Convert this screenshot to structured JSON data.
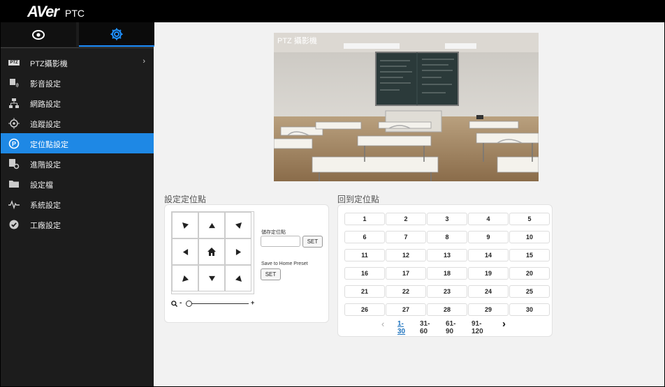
{
  "app": {
    "logo": "AVer",
    "product": "PTC"
  },
  "sidebar": {
    "items": [
      {
        "label": "PTZ攝影機",
        "icon": "ptz-badge-icon",
        "badge": "PTZ",
        "has_arrow": true
      },
      {
        "label": "影音設定",
        "icon": "camera-audio-icon"
      },
      {
        "label": "網路設定",
        "icon": "network-icon"
      },
      {
        "label": "追蹤設定",
        "icon": "tracking-icon"
      },
      {
        "label": "定位點設定",
        "icon": "preset-icon",
        "active": true
      },
      {
        "label": "進階設定",
        "icon": "advanced-settings-icon"
      },
      {
        "label": "設定檔",
        "icon": "folder-icon"
      },
      {
        "label": "系統設定",
        "icon": "pulse-icon"
      },
      {
        "label": "工廠設定",
        "icon": "check-circle-icon"
      }
    ],
    "arrow_glyph": "›"
  },
  "preview": {
    "label": "PTZ 攝影機"
  },
  "set_preset": {
    "title": "設定定位點",
    "save_preset_label": "儲存定位點",
    "set_button": "SET",
    "save_home_label": "Save to Home Preset",
    "set_home_button": "SET",
    "zoom_minus": "-",
    "zoom_plus": "+",
    "zoom_level": 0
  },
  "recall_preset": {
    "title": "回到定位點",
    "presets": [
      "1",
      "2",
      "3",
      "4",
      "5",
      "6",
      "7",
      "8",
      "9",
      "10",
      "11",
      "12",
      "13",
      "14",
      "15",
      "16",
      "17",
      "18",
      "19",
      "20",
      "21",
      "22",
      "23",
      "24",
      "25",
      "26",
      "27",
      "28",
      "29",
      "30"
    ],
    "pages": [
      "1-30",
      "31-60",
      "61-90",
      "91-120"
    ],
    "current_page": "1-30",
    "prev": "‹",
    "next": "›"
  },
  "colors": {
    "accent": "#1e88e5",
    "sidebar_bg": "#1c1c1c",
    "topbar_bg": "#000000",
    "content_bg": "#f2f2f2"
  }
}
